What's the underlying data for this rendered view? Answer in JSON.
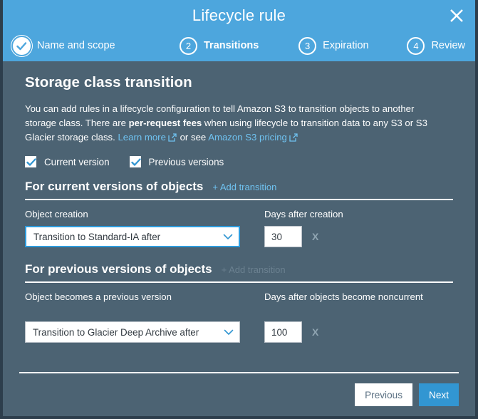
{
  "header": {
    "title": "Lifecycle rule",
    "close_label": "×",
    "steps": [
      {
        "badge": "✓",
        "label": "Name and scope",
        "state": "done"
      },
      {
        "badge": "2",
        "label": "Transitions",
        "state": "active"
      },
      {
        "badge": "3",
        "label": "Expiration",
        "state": "upcoming"
      },
      {
        "badge": "4",
        "label": "Review",
        "state": "upcoming"
      }
    ]
  },
  "main": {
    "section_title": "Storage class transition",
    "description": {
      "part1": "You can add rules in a lifecycle configuration to tell Amazon S3 to transition objects to another storage class. There are ",
      "bold": "per-request fees",
      "part2": " when using lifecycle to transition data to any S3 or S3 Glacier storage class. ",
      "link1": "Learn more",
      "part3": " or see ",
      "link2": "Amazon S3 pricing"
    },
    "checkboxes": [
      {
        "label": "Current version",
        "checked": true
      },
      {
        "label": "Previous versions",
        "checked": true
      }
    ],
    "current_versions": {
      "group_title": "For current versions of objects",
      "add_link": "+ Add transition",
      "add_link_disabled": false,
      "left_label": "Object creation",
      "right_label": "Days after creation",
      "select_value": "Transition to Standard-IA after",
      "days_value": "30",
      "remove_label": "X"
    },
    "previous_versions": {
      "group_title": "For previous versions of objects",
      "add_link": "+ Add transition",
      "add_link_disabled": true,
      "left_label": "Object becomes a previous version",
      "right_label": "Days after objects become noncurrent",
      "select_value": "Transition to Glacier Deep Archive after",
      "days_value": "100",
      "remove_label": "X"
    }
  },
  "footer": {
    "previous_label": "Previous",
    "next_label": "Next"
  },
  "colors": {
    "header_blue": "#4da6dd",
    "body_slate": "#4c6373",
    "link_blue": "#6fc2f0",
    "primary_button": "#3296d2",
    "border_dark": "#2d3e4c"
  }
}
